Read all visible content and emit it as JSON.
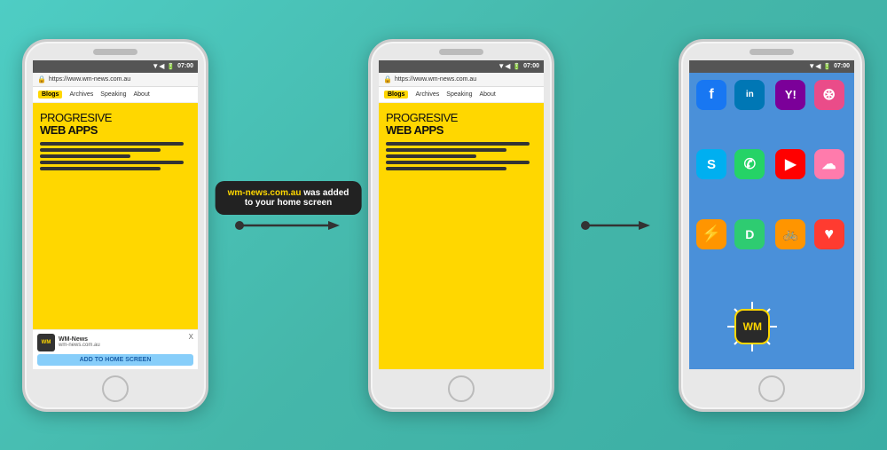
{
  "scene": {
    "background": "#45b7aa"
  },
  "phone1": {
    "time": "07:00",
    "url": "https://www.wm-news.com.au",
    "nav": [
      "Blogs",
      "Archives",
      "Speaking",
      "About"
    ],
    "active_nav": "Blogs",
    "title_light": "PROGRESIVE",
    "title_bold": "WEB APPS",
    "banner": {
      "site_name": "WM-News",
      "site_url": "wm-news.com.au",
      "button_label": "ADD TO HOME SCREEN",
      "close_label": "X"
    }
  },
  "phone2": {
    "time": "07:00",
    "url": "https://www.wm-news.com.au",
    "nav": [
      "Blogs",
      "Archives",
      "Speaking",
      "About"
    ],
    "active_nav": "Blogs",
    "title_light": "PROGRESIVE",
    "title_bold": "WEB APPS",
    "notification": {
      "line1_site": "wm-news.com.au",
      "line1_suffix": " was added",
      "line2": "to your home screen"
    }
  },
  "phone3": {
    "time": "07:00",
    "wm_label": "WM",
    "apps": [
      {
        "id": "facebook",
        "label": "f"
      },
      {
        "id": "linkedin",
        "label": "in"
      },
      {
        "id": "yahoo",
        "label": "Y!"
      },
      {
        "id": "dribbble",
        "label": "⦿"
      },
      {
        "id": "skype",
        "label": "S"
      },
      {
        "id": "whatsapp",
        "label": "✆"
      },
      {
        "id": "youtube",
        "label": "▶"
      },
      {
        "id": "cloud",
        "label": "☁"
      },
      {
        "id": "bolt",
        "label": "⚡"
      },
      {
        "id": "d-app",
        "label": "D"
      },
      {
        "id": "bike",
        "label": "🚴"
      },
      {
        "id": "heart",
        "label": "♥"
      }
    ]
  },
  "notification_text": {
    "site": "wm-news.com.au",
    "was_added": " was added",
    "to_home": "to your home screen"
  }
}
